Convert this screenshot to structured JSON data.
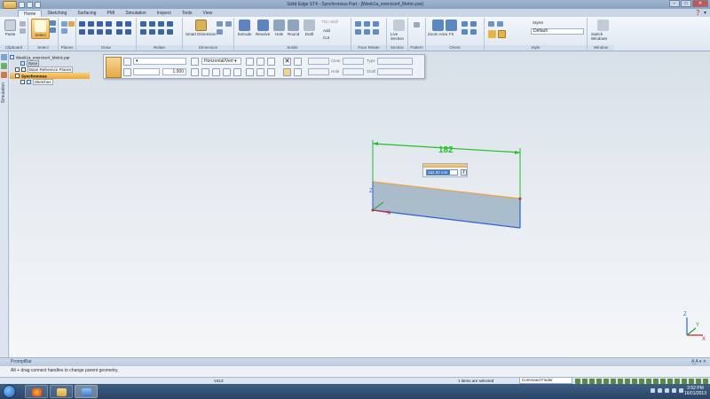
{
  "window": {
    "title": "Solid Edge ST4 - Synchronous Part - [Week1a_exercice4_Metric.par]"
  },
  "ribbon": {
    "tabs": [
      "Home",
      "Sketching",
      "Surfacing",
      "PMI",
      "Simulation",
      "Inspect",
      "Tools",
      "View"
    ],
    "active_tab": "Home",
    "groups": [
      {
        "label": "Clipboard",
        "buttons": [
          "Paste"
        ]
      },
      {
        "label": "Select",
        "buttons": [
          "Select"
        ]
      },
      {
        "label": "Planes",
        "buttons": []
      },
      {
        "label": "Draw",
        "buttons": []
      },
      {
        "label": "Relate",
        "buttons": []
      },
      {
        "label": "Dimension",
        "buttons": [
          "Smart Dimension"
        ]
      },
      {
        "label": "Solids",
        "buttons": [
          "Extrude",
          "Revolve",
          "Hole",
          "Round",
          "Draft",
          "Thin Wall",
          "Add",
          "Cut"
        ]
      },
      {
        "label": "Face Relate",
        "buttons": []
      },
      {
        "label": "Section",
        "buttons": [
          "Live Section"
        ]
      },
      {
        "label": "Pattern",
        "buttons": []
      },
      {
        "label": "Orient",
        "buttons": [
          "Zoom Area",
          "Fit"
        ]
      },
      {
        "label": "Style",
        "buttons": [
          "Styles"
        ]
      },
      {
        "label": "Window",
        "buttons": [
          "Switch Windows"
        ]
      }
    ],
    "style_value": "Default"
  },
  "command_bar": {
    "layer": "▾",
    "dim_mode": "Horizontal/Vert ▾",
    "value": "1.000",
    "clear_label": "Clear",
    "type_label": "Type",
    "hole_label": "Hole",
    "shaft_label": "Shaft"
  },
  "pathfinder": {
    "file": "Week1a_exercice4_Metric.par",
    "items": [
      "Base",
      "Base Reference Planes",
      "Synchronous",
      "Sketches"
    ]
  },
  "left_strip": {
    "tab_label": "Simulation"
  },
  "graphics": {
    "dimension_value": "182",
    "edit_value": "182.00 mm",
    "triad": {
      "x": "X",
      "y": "Y",
      "z": "Z"
    }
  },
  "prompt": {
    "title": "PromptBar",
    "text": "Alt + drag connect handles to change parent geometry."
  },
  "status": {
    "version": "V413",
    "selection": "1 items are selected",
    "command_finder": "Command Finder"
  },
  "taskbar": {
    "time": "3:52 PM",
    "date": "16/01/2013"
  },
  "colors": {
    "accent": "#e6a94a",
    "dimension_green": "#22c02a",
    "edge_blue": "#2f5fd6",
    "edge_orange": "#f0a03a",
    "fill": "#9fb4c4"
  }
}
